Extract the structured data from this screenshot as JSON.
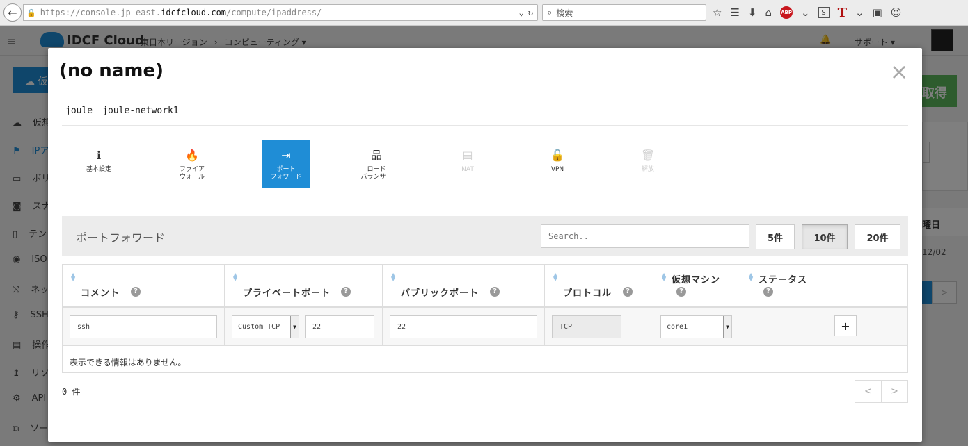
{
  "browser": {
    "url_prefix": "https://console.jp-east.",
    "url_domain": "idcfcloud.com",
    "url_path": "/compute/ipaddress/",
    "search_placeholder": "検索"
  },
  "app": {
    "logo": "IDCF Cloud",
    "region": "東日本リージョン",
    "breadcrumb_sep": "›",
    "service": "コンピューティング",
    "support": "サポート",
    "left_button_fragment": "仮",
    "right_button_fragment": "取得",
    "right_col_fragment": "曜日",
    "right_date_fragment": "12/02",
    "sidebar": [
      {
        "label": "仮想"
      },
      {
        "label": "IPア"
      },
      {
        "label": "ボリ"
      },
      {
        "label": "スナ"
      },
      {
        "label": "テン"
      },
      {
        "label": "ISO"
      },
      {
        "label": "ネッ"
      },
      {
        "label": "SSH"
      },
      {
        "label": "操作"
      },
      {
        "label": "リソ"
      },
      {
        "label": "API"
      },
      {
        "label": "ソー"
      }
    ]
  },
  "modal": {
    "title": "(no name)",
    "close": "×",
    "crumbs": [
      "joule",
      "joule-network1"
    ],
    "tabs": [
      {
        "icon": "ℹ",
        "label1": "基本設定",
        "label2": ""
      },
      {
        "icon": "🔥",
        "label1": "ファイア",
        "label2": "ウォール"
      },
      {
        "icon": "⇥",
        "label1": "ポート",
        "label2": "フォワード"
      },
      {
        "icon": "品",
        "label1": "ロード",
        "label2": "バランサー"
      },
      {
        "icon": "▤",
        "label1": "NAT",
        "label2": ""
      },
      {
        "icon": "🔓",
        "label1": "VPN",
        "label2": ""
      },
      {
        "icon": "🗑",
        "label1": "解放",
        "label2": ""
      }
    ],
    "section_title": "ポートフォワード",
    "search_placeholder": "Search..",
    "page_sizes": [
      "5件",
      "10件",
      "20件"
    ],
    "columns": [
      {
        "label": "コメント"
      },
      {
        "label": "プライベートポート"
      },
      {
        "label": "パブリックポート"
      },
      {
        "label": "プロトコル"
      },
      {
        "label": "仮想マシン"
      },
      {
        "label": "ステータス"
      },
      {
        "label": ""
      }
    ],
    "help_glyph": "?",
    "form": {
      "comment": "ssh",
      "private_protocol": "Custom TCP",
      "private_port": "22",
      "public_port": "22",
      "protocol": "TCP",
      "vm": "core1",
      "add": "+"
    },
    "empty_message": "表示できる情報はありません。",
    "count": "0 件",
    "prev": "<",
    "next": ">"
  }
}
